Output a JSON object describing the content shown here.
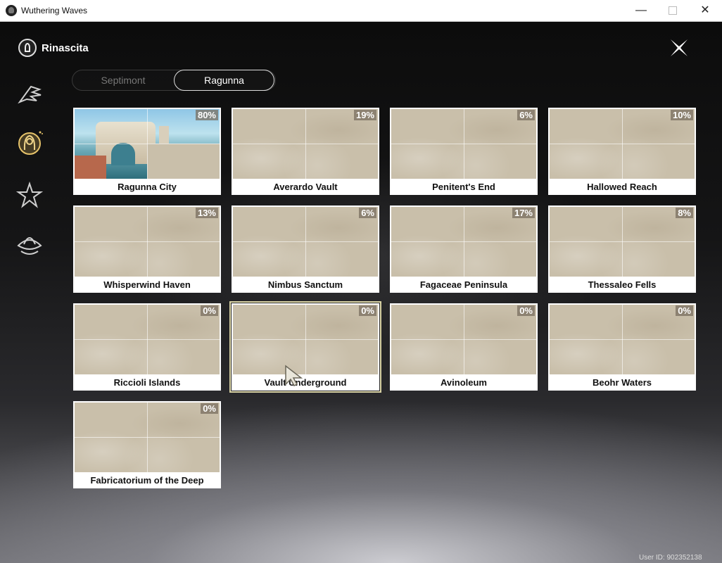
{
  "window": {
    "title": "Wuthering Waves",
    "minimize_glyph": "—",
    "close_glyph": "✕"
  },
  "header": {
    "logo_text": "Rinascita"
  },
  "sidebar": {
    "icons": [
      "wing-emblem-icon",
      "character-emblem-icon",
      "star-emblem-icon",
      "lotus-emblem-icon"
    ],
    "active_index": 1
  },
  "tabs": [
    {
      "label": "Septimont",
      "active": false
    },
    {
      "label": "Ragunna",
      "active": true
    }
  ],
  "regions": [
    {
      "name": "Ragunna City",
      "progress": "80%"
    },
    {
      "name": "Averardo Vault",
      "progress": "19%"
    },
    {
      "name": "Penitent's End",
      "progress": "6%"
    },
    {
      "name": "Hallowed Reach",
      "progress": "10%"
    },
    {
      "name": "Whisperwind Haven",
      "progress": "13%"
    },
    {
      "name": "Nimbus Sanctum",
      "progress": "6%"
    },
    {
      "name": "Fagaceae Peninsula",
      "progress": "17%"
    },
    {
      "name": "Thessaleo Fells",
      "progress": "8%"
    },
    {
      "name": "Riccioli Islands",
      "progress": "0%"
    },
    {
      "name": "Vault Underground",
      "progress": "0%"
    },
    {
      "name": "Avinoleum",
      "progress": "0%"
    },
    {
      "name": "Beohr Waters",
      "progress": "0%"
    },
    {
      "name": "Fabricatorium of the Deep",
      "progress": "0%"
    }
  ],
  "selected_region": "Vault Underground",
  "footer": {
    "user_id": "User ID: 902352138"
  },
  "colors": {
    "selection_outline": "#d9d3a4",
    "map_thumb": "#c9bfaa"
  }
}
